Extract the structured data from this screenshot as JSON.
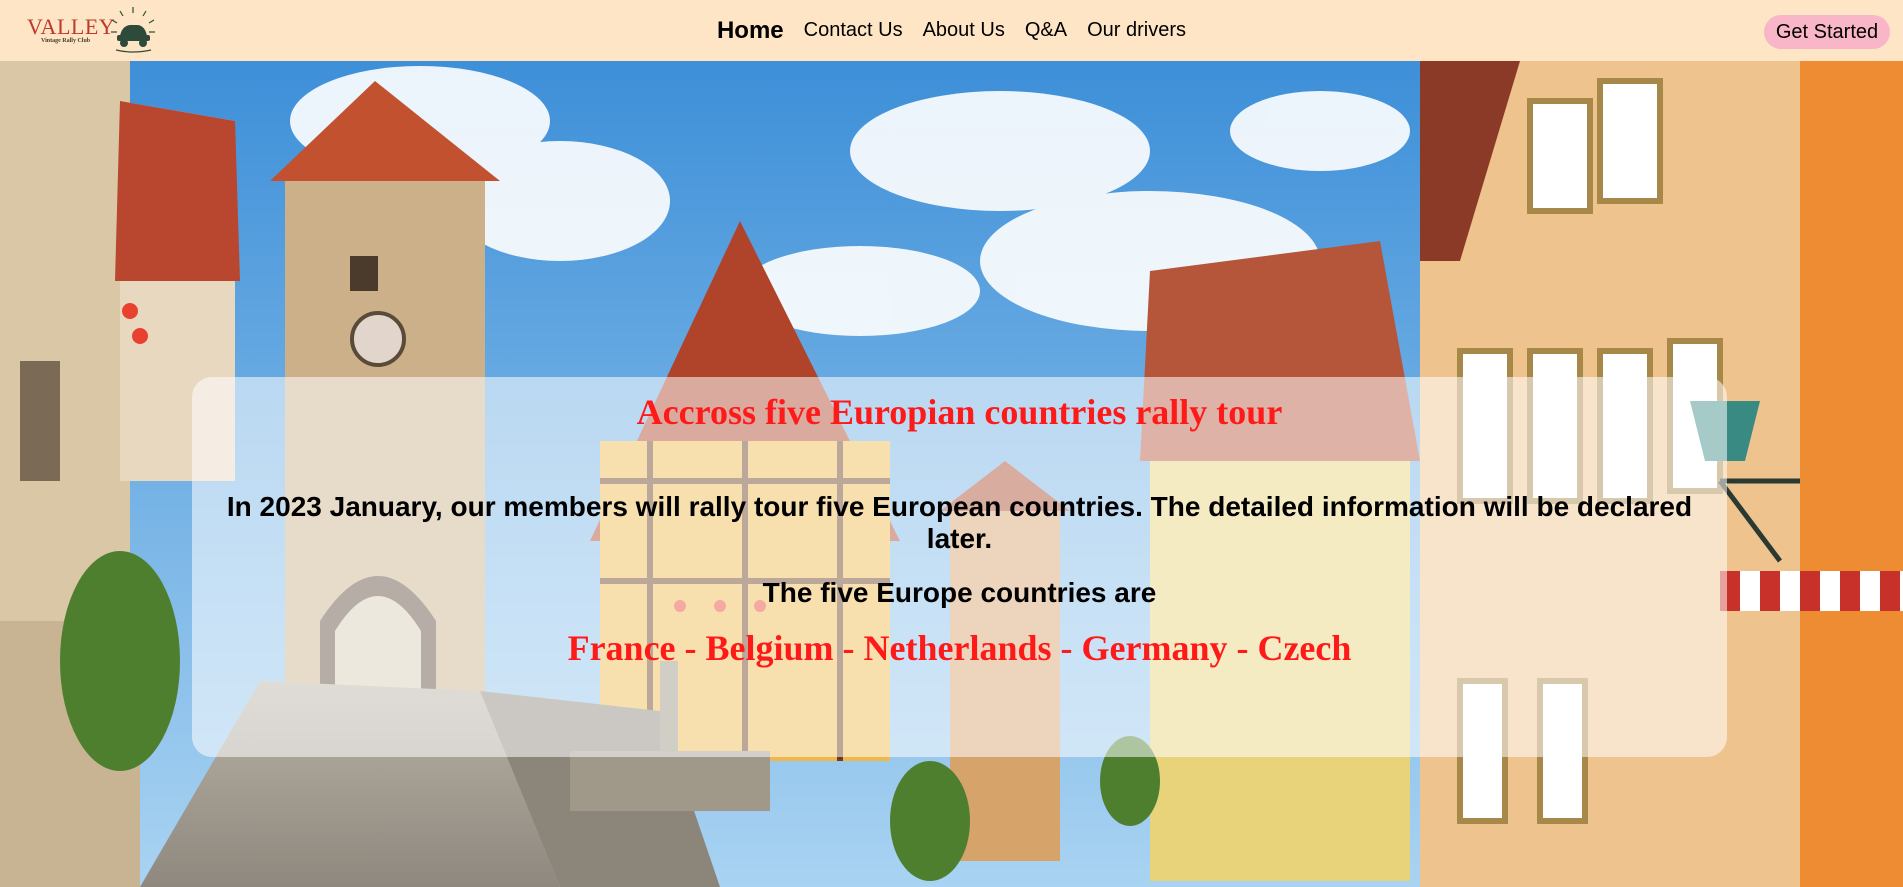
{
  "brand": {
    "logo_word": "VALLEY",
    "logo_sub": "Vintage Rally Club",
    "logo_icon": "car-emblem-icon"
  },
  "nav": {
    "items": [
      {
        "label": "Home",
        "active": true
      },
      {
        "label": "Contact Us",
        "active": false
      },
      {
        "label": "About Us",
        "active": false
      },
      {
        "label": "Q&A",
        "active": false
      },
      {
        "label": "Our drivers",
        "active": false
      }
    ],
    "cta_label": "Get Started"
  },
  "hero": {
    "title": "Accross five Europian countries rally tour",
    "description": "In 2023 January, our members will rally tour five European countries. The detailed information will be declared later.",
    "subtitle": "The five Europe countries are",
    "countries": "France - Belgium - Netherlands - Germany - Czech"
  },
  "colors": {
    "nav_bg": "#fde5c5",
    "cta_bg": "#f9b6c8",
    "accent_red": "#ff1a1a"
  }
}
